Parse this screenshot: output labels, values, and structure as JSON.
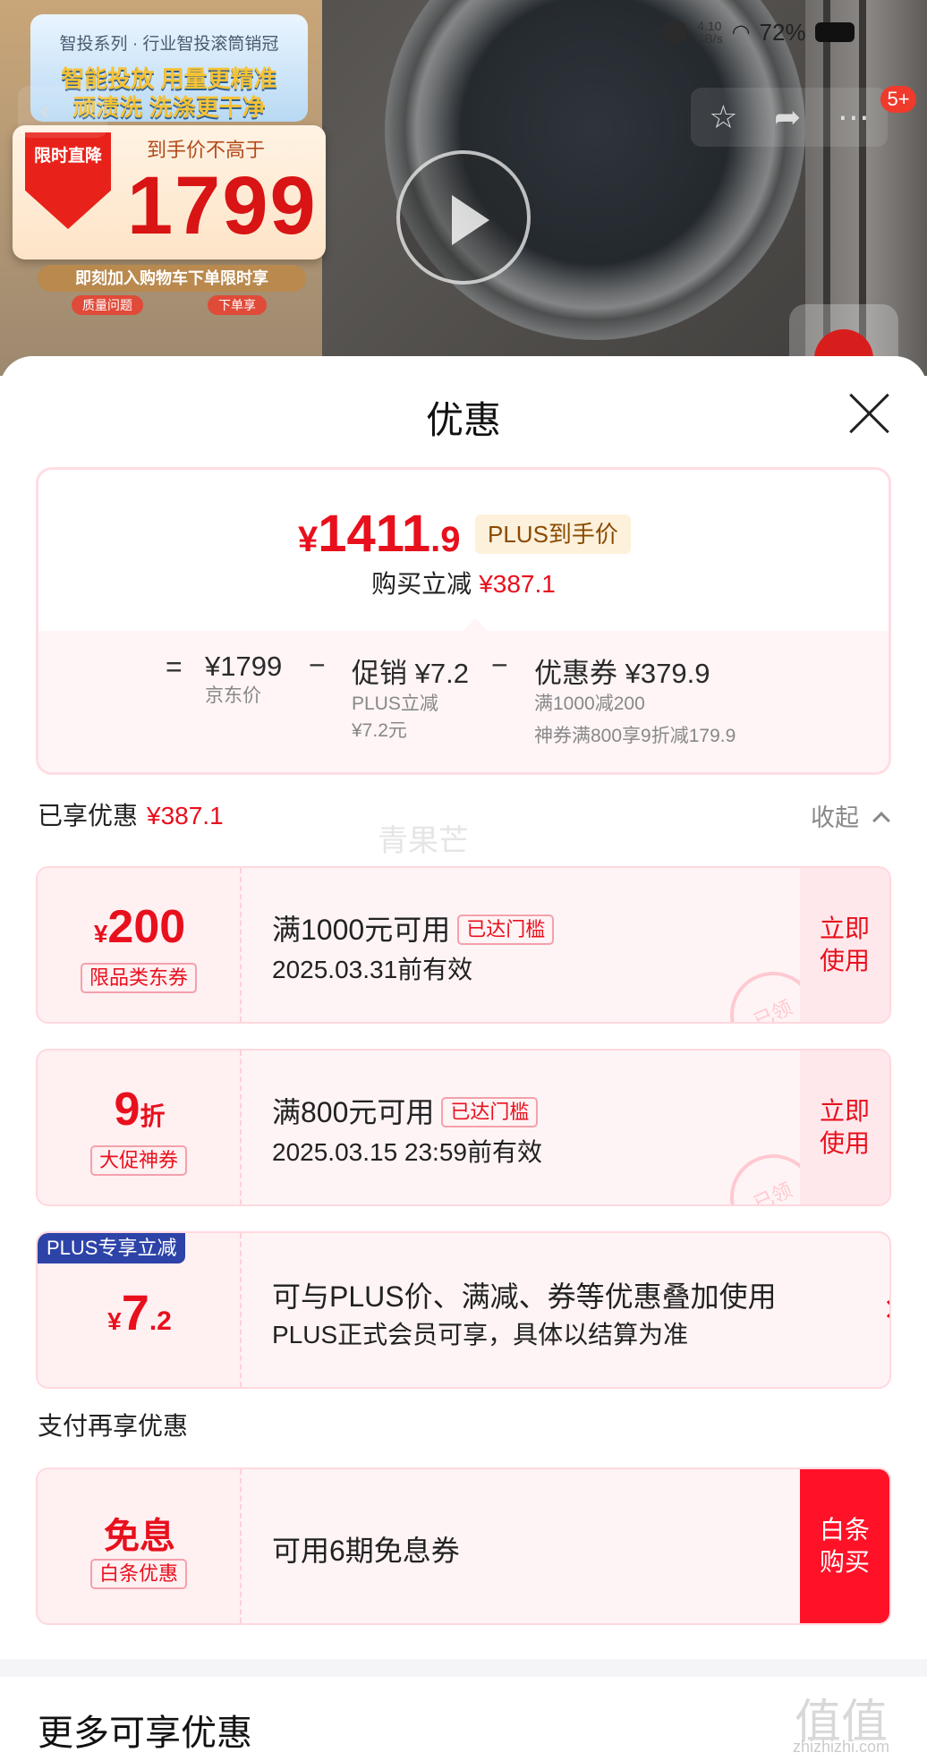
{
  "status_bar": {
    "speed_value": "4.10",
    "speed_unit": "KB/s",
    "battery": "72%"
  },
  "nav": {
    "badge": "5+"
  },
  "poster": {
    "series": "智投系列 · 行业智投滚筒销冠",
    "line1": "智能投放 用量更精准",
    "line2": "顽渍洗 洗涤更干净",
    "badge": "限时直降",
    "price_label": "到手价不高于",
    "price": "1799",
    "bar": "即刻加入购物车下单限时享",
    "chip1": "质量问题",
    "chip2": "下单享"
  },
  "sheet": {
    "title": "优惠",
    "summary": {
      "yen": "¥",
      "final_int": "1411",
      "final_dec": ".9",
      "plus_tag": "PLUS到手价",
      "discount_label": "购买立减",
      "discount_value": "¥387.1",
      "eq": "=",
      "minus": "−",
      "jd_price": "¥1799",
      "jd_label": "京东价",
      "promo_main": "促销 ¥7.2",
      "promo_sub1": "PLUS立减",
      "promo_sub2": "¥7.2元",
      "coupon_main": "优惠券 ¥379.9",
      "coupon_sub1": "满1000减200",
      "coupon_sub2": "神券满800享9折减179.9"
    },
    "enjoyed_label": "已享优惠",
    "enjoyed_value": "¥387.1",
    "collapse_label": "收起",
    "watermark": "青果芒",
    "coupons": [
      {
        "yen": "¥",
        "amount": "200",
        "tag": "限品类东券",
        "condition": "满1000元可用",
        "threshold": "已达门槛",
        "validity": "2025.03.31前有效",
        "action": [
          "立即",
          "使用"
        ],
        "stamp": "已领"
      },
      {
        "amount": "9",
        "unit": "折",
        "tag": "大促神券",
        "condition": "满800元可用",
        "threshold": "已达门槛",
        "validity": "2025.03.15 23:59前有效",
        "action": [
          "立即",
          "使用"
        ],
        "stamp": "已领"
      }
    ],
    "plus_card": {
      "label": "PLUS专享立减",
      "yen": "¥",
      "amount_int": "7",
      "amount_dec": ".2",
      "desc1": "可与PLUS价、满减、券等优惠叠加使用",
      "desc2": "PLUS正式会员可享，具体以结算为准"
    },
    "pay_title": "支付再享优惠",
    "pay_card": {
      "title": "免息",
      "tag": "白条优惠",
      "desc": "可用6期免息券",
      "action": [
        "白条",
        "购买"
      ]
    },
    "more_title": "更多可享优惠"
  },
  "footer_watermark": {
    "mark": "值值值",
    "url": "zhizhizhi.com"
  },
  "colors": {
    "accent_red": "#e8101d",
    "plus_blue": "#2d43a8",
    "pay_red": "#ff1228"
  }
}
